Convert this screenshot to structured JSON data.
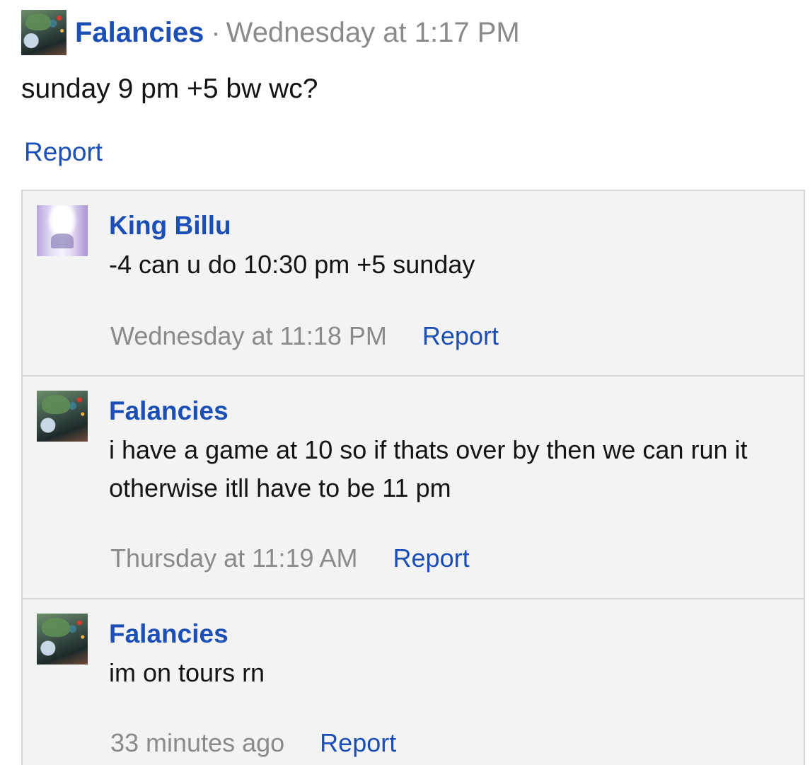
{
  "post": {
    "author": "Falancies",
    "separator": "·",
    "time": "Wednesday at 1:17 PM",
    "body": "sunday 9 pm +5 bw wc?",
    "report_label": "Report"
  },
  "comments": [
    {
      "author": "King Billu",
      "text": "-4 can u do 10:30 pm +5 sunday",
      "time": "Wednesday at 11:18 PM",
      "report_label": "Report"
    },
    {
      "author": "Falancies",
      "text": "i have a game at 10 so if thats over by then we can run it otherwise itll have to be 11 pm",
      "time": "Thursday at 11:19 AM",
      "report_label": "Report"
    },
    {
      "author": "Falancies",
      "text": "im on tours rn",
      "time": "33 minutes ago",
      "report_label": "Report"
    }
  ],
  "colors": {
    "link": "#1b4fb5",
    "muted": "#8a8a8a",
    "comment_bg": "#f3f3f3",
    "border": "#d6d6d6"
  }
}
